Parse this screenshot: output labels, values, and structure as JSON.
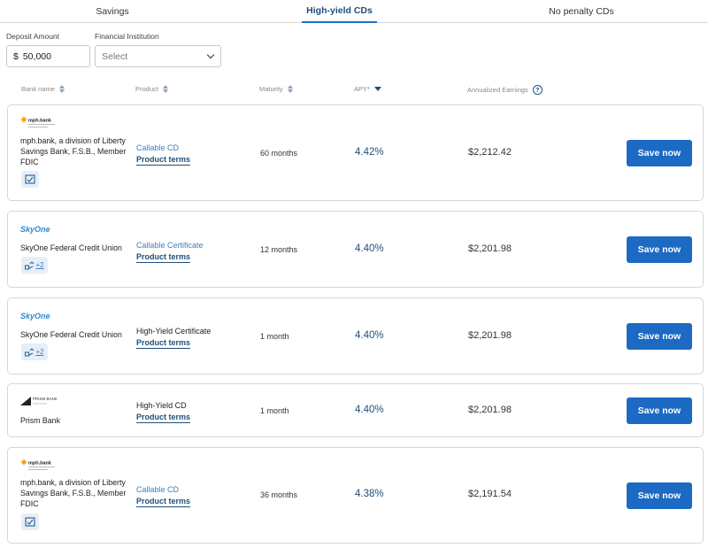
{
  "tabs": [
    {
      "label": "Savings"
    },
    {
      "label": "High-yield CDs"
    },
    {
      "label": "No penalty CDs"
    }
  ],
  "filters": {
    "deposit_label": "Deposit Amount",
    "currency": "$",
    "deposit_value": "50,000",
    "institution_label": "Financial Institution",
    "institution_value": "Select"
  },
  "columns": {
    "bank": "Bank name",
    "product": "Product",
    "maturity": "Maturity",
    "apy": "APY*",
    "earnings": "Annualized Earnings",
    "help": "?"
  },
  "rows": [
    {
      "bank": "mph.bank, a division of Liberty Savings Bank, F.S.B., Member FDIC",
      "logo_text": "mph.bank",
      "product": "Callable CD",
      "terms": "Product terms",
      "maturity": "60 months",
      "apy": "4.42%",
      "earnings": "$2,212.42",
      "cta": "Save now",
      "extra": ""
    },
    {
      "bank": "SkyOne Federal Credit Union",
      "logo_text": "SkyOne",
      "product": "Callable Certificate",
      "terms": "Product terms",
      "maturity": "12 months",
      "apy": "4.40%",
      "earnings": "$2,201.98",
      "cta": "Save now",
      "extra": "+2"
    },
    {
      "bank": "SkyOne Federal Credit Union",
      "logo_text": "SkyOne",
      "product": "High-Yield Certificate",
      "terms": "Product terms",
      "maturity": "1 month",
      "apy": "4.40%",
      "earnings": "$2,201.98",
      "cta": "Save now",
      "extra": "+2"
    },
    {
      "bank": "Prism Bank",
      "logo_text": "PRISM BANK",
      "product": "High-Yield CD",
      "terms": "Product terms",
      "maturity": "1 month",
      "apy": "4.40%",
      "earnings": "$2,201.98",
      "cta": "Save now",
      "extra": ""
    },
    {
      "bank": "mph.bank, a division of Liberty Savings Bank, F.S.B., Member FDIC",
      "logo_text": "mph.bank",
      "product": "Callable CD",
      "terms": "Product terms",
      "maturity": "36 months",
      "apy": "4.38%",
      "earnings": "$2,191.54",
      "cta": "Save now",
      "extra": ""
    }
  ],
  "colors": {
    "accent": "#1c6ac3",
    "navy": "#1f4f7a",
    "link": "#3a7fc0",
    "skyone_blue": "#2a8ccf",
    "skyone_green": "#7bbf3a",
    "mph_orange": "#f2a51c"
  },
  "icons": [
    "sort-icon",
    "sort-desc-icon",
    "help-icon",
    "chevron-down-icon",
    "checkbox-icon",
    "feature-icon"
  ]
}
